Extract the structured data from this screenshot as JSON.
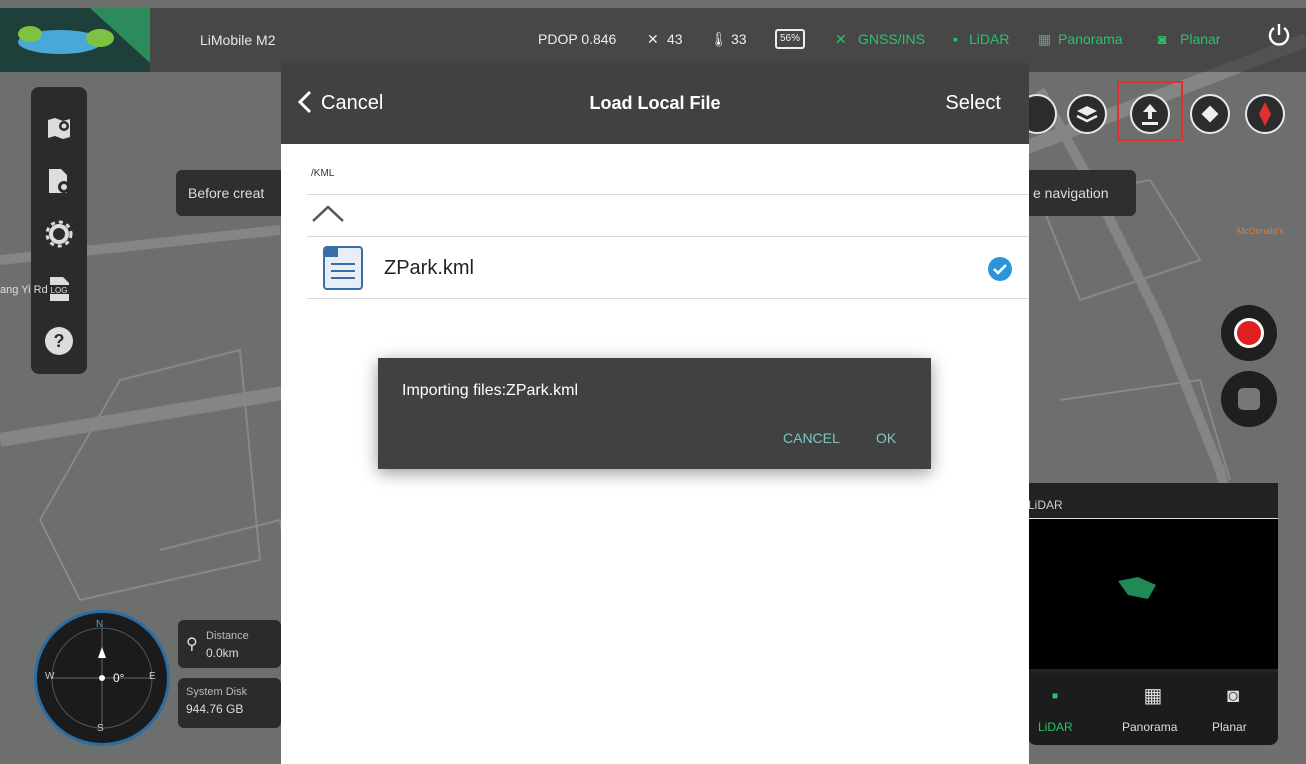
{
  "app": {
    "name": "LiMobile M2"
  },
  "status_bar": {
    "pdop": "PDOP 0.846",
    "satellites": "43",
    "temperature": "33",
    "battery": "56%",
    "gnss": "GNSS/INS",
    "lidar": "LiDAR",
    "panorama": "Panorama",
    "planar": "Planar",
    "power_icon": "power-icon"
  },
  "map": {
    "road_label": "ang Yi Rd",
    "poi_label": "McDonald's"
  },
  "toasts": {
    "left": "Before creat",
    "right": "e navigation"
  },
  "sidebar": {
    "items": [
      {
        "icon": "map-add-icon"
      },
      {
        "icon": "file-settings-icon"
      },
      {
        "icon": "gear-icon"
      },
      {
        "icon": "log-icon",
        "label": "LOG"
      },
      {
        "icon": "help-icon",
        "label": "?"
      }
    ]
  },
  "dialog": {
    "cancel_label": "Cancel",
    "title": "Load Local File",
    "select_label": "Select",
    "path": "/KML",
    "files": [
      {
        "name": "ZPark.kml",
        "selected": true
      }
    ]
  },
  "modal": {
    "message": "Importing files:ZPark.kml",
    "cancel_label": "CANCEL",
    "ok_label": "OK"
  },
  "lidar_panel": {
    "title": "LiDAR"
  },
  "modes": [
    {
      "label": "LiDAR"
    },
    {
      "label": "Panorama"
    },
    {
      "label": "Planar"
    }
  ],
  "compass": {
    "heading": "0°",
    "north": "N",
    "east": "E",
    "south": "S",
    "west": "W"
  },
  "info": {
    "distance_label": "Distance",
    "distance_value": "0.0km",
    "disk_label": "System Disk",
    "disk_value": "944.76 GB"
  },
  "colors": {
    "accent_green": "#27c46a",
    "highlight_red": "#e03030",
    "check_blue": "#2b95d8",
    "modal_button": "#7ec8c3"
  }
}
